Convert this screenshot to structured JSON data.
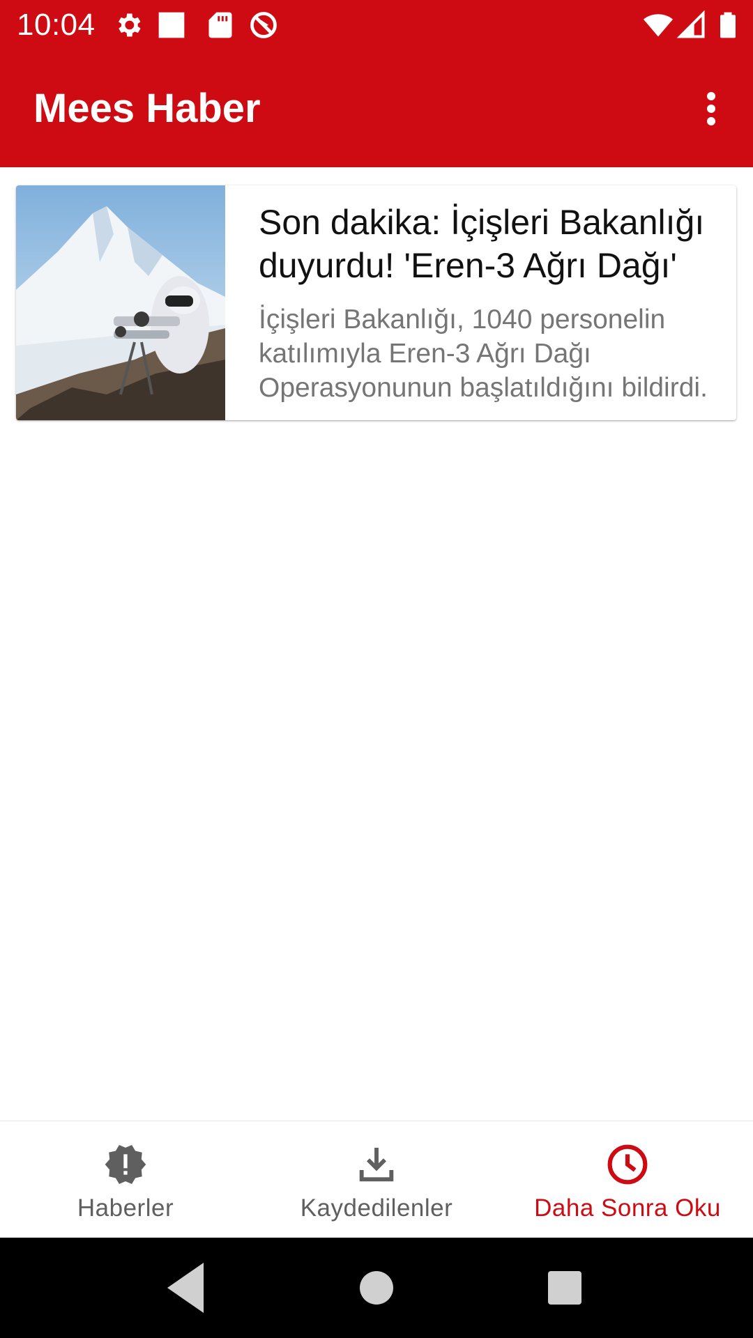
{
  "status_bar": {
    "time": "10:04",
    "icons": [
      "settings-icon",
      "square-notification-icon",
      "sd-card-icon",
      "do-not-disturb-icon",
      "wifi-icon",
      "signal-icon",
      "battery-icon"
    ]
  },
  "app_bar": {
    "title": "Mees Haber",
    "overflow_icon": "more-vert-icon"
  },
  "news": [
    {
      "title": "Son dakika: İçişleri Bakanlığı duyurdu! 'Eren-3 Ağrı Dağı'",
      "summary": "İçişleri Bakanlığı, 1040 personelin katılımıyla Eren-3 Ağrı Dağı Operasyonunun başlatıldığını bildirdi.",
      "image": "mountain-soldier-photo"
    }
  ],
  "bottom_nav": {
    "items": [
      {
        "label": "Haberler",
        "icon": "alert-badge-icon",
        "active": false
      },
      {
        "label": "Kaydedilenler",
        "icon": "download-icon",
        "active": false
      },
      {
        "label": "Daha Sonra Oku",
        "icon": "clock-icon",
        "active": true
      }
    ]
  },
  "system_nav": {
    "buttons": [
      "back-icon",
      "home-icon",
      "recents-icon"
    ]
  },
  "colors": {
    "primary": "#ce0b12",
    "nav_inactive": "#5f5f5f",
    "summary_text": "#757575",
    "system_nav_bg": "#000000"
  }
}
